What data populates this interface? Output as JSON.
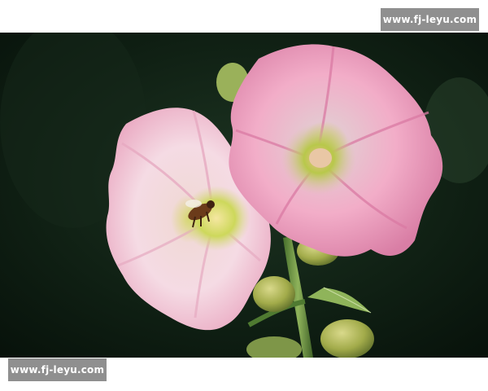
{
  "watermark": {
    "top_text": "www.fj-leyu.com",
    "bottom_text": "www.fj-leyu.com",
    "background_color": "#8f8f8f",
    "text_color": "#ffffff"
  },
  "photo": {
    "subject": "pink hollyhock flowers with a bee",
    "colors": {
      "background": "#0f1f13",
      "petal_light": "#f7dbe3",
      "petal_pink": "#ef9fbc",
      "center_green": "#c6cf57",
      "stem_green": "#6f9a3e",
      "bee": "#6b3b1a"
    }
  }
}
